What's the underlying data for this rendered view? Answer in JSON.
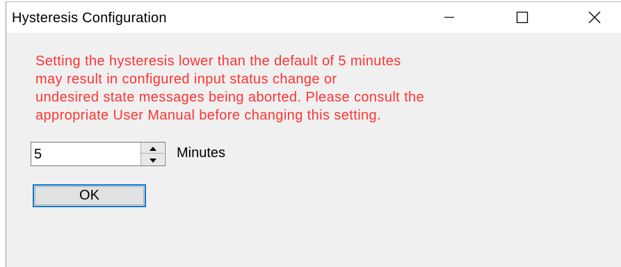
{
  "window": {
    "title": "Hysteresis Configuration",
    "controls": [
      "minimize-icon",
      "maximize-icon",
      "close-icon"
    ]
  },
  "warning": {
    "color": "#ff3333",
    "lines": [
      "Setting the hysteresis lower than the default of 5 minutes",
      "may result in configured input status change or",
      "undesired state messages being aborted. Please consult the",
      "appropriate User Manual before changing this setting."
    ]
  },
  "hysteresis": {
    "value": "5",
    "unit_label": "Minutes"
  },
  "buttons": {
    "ok_label": "OK",
    "focus_color": "#0078d7"
  }
}
